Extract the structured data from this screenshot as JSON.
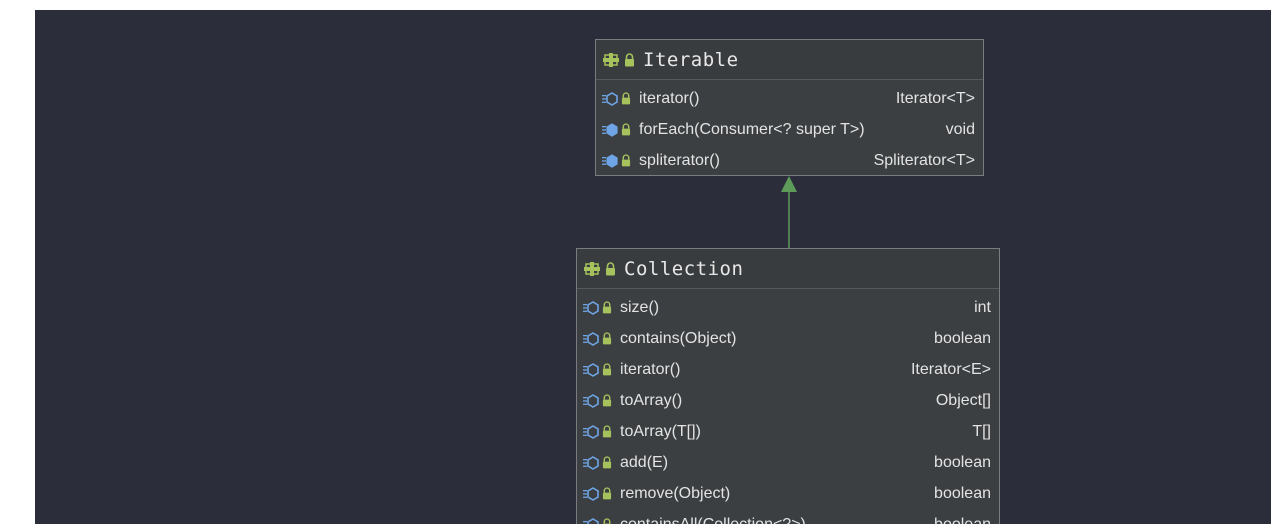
{
  "diagram": {
    "colors": {
      "background": "#2b2d3a",
      "box": "#3c3f41",
      "border": "#7a7c80",
      "edge": "#5e9a5a",
      "interface_icon": "#a5c25c",
      "method_icon": "#6fa5e6",
      "lock": "#a5c25c"
    },
    "interfaces": [
      {
        "name": "Iterable",
        "methods": [
          {
            "name": "iterator()",
            "type": "Iterator<T>"
          },
          {
            "name": "forEach(Consumer<? super T>)",
            "type": "void"
          },
          {
            "name": "spliterator()",
            "type": "Spliterator<T>"
          }
        ]
      },
      {
        "name": "Collection",
        "methods": [
          {
            "name": "size()",
            "type": "int"
          },
          {
            "name": "contains(Object)",
            "type": "boolean"
          },
          {
            "name": "iterator()",
            "type": "Iterator<E>"
          },
          {
            "name": "toArray()",
            "type": "Object[]"
          },
          {
            "name": "toArray(T[])",
            "type": "T[]"
          },
          {
            "name": "add(E)",
            "type": "boolean"
          },
          {
            "name": "remove(Object)",
            "type": "boolean"
          },
          {
            "name": "containsAll(Collection<?>)",
            "type": "boolean"
          }
        ]
      }
    ],
    "edges": [
      {
        "from": "Collection",
        "to": "Iterable",
        "kind": "extends"
      }
    ]
  }
}
